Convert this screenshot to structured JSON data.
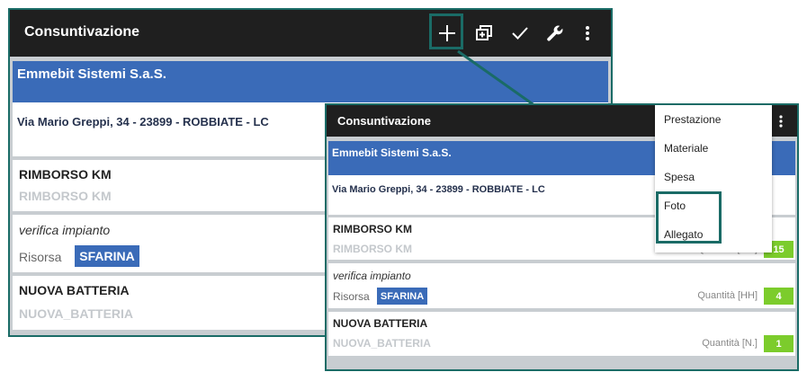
{
  "app": {
    "title": "Consuntivazione"
  },
  "toolbar": {
    "add_icon": "plus-icon",
    "copy_icon": "duplicate-add-icon",
    "confirm_icon": "check-icon",
    "tools_icon": "wrench-icon",
    "more_icon": "more-vert-icon"
  },
  "customer": {
    "name": "Emmebit Sistemi S.a.S.",
    "address": "Via Mario Greppi, 34 - 23899 - ROBBIATE - LC"
  },
  "items": [
    {
      "title": "RIMBORSO KM",
      "code": "RIMBORSO KM",
      "quantity_label": "Quantità [KM]",
      "quantity": "15"
    },
    {
      "title": "verifica impianto",
      "resource_label": "Risorsa",
      "resource": "SFARINA",
      "quantity_label": "Quantità [HH]",
      "quantity": "4"
    },
    {
      "title": "NUOVA BATTERIA",
      "code": "NUOVA_BATTERIA",
      "quantity_label": "Quantità [N.]",
      "quantity": "1"
    }
  ],
  "add_menu": {
    "items": [
      "Prestazione",
      "Materiale",
      "Spesa",
      "Foto",
      "Allegato"
    ]
  },
  "colors": {
    "appbar": "#1f1f1f",
    "header_blue": "#3a6bb8",
    "highlight": "#1a6b66",
    "quantity_green": "#7ccc2c"
  }
}
